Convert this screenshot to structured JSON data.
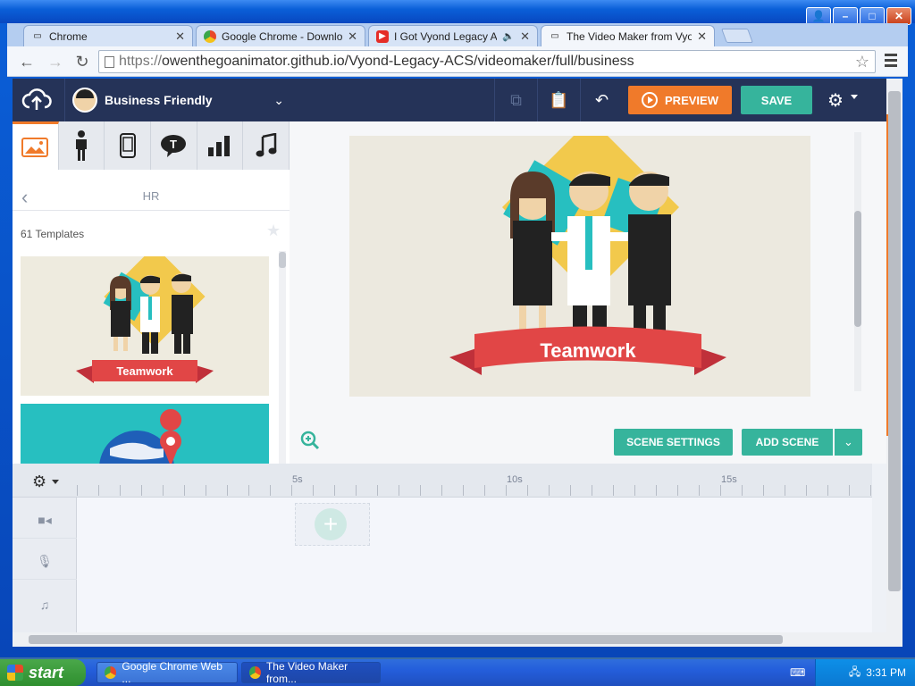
{
  "browser": {
    "tabs": [
      {
        "title": "Chrome"
      },
      {
        "title": "Google Chrome - Download t"
      },
      {
        "title": "I Got Vyond Legacy ACS"
      },
      {
        "title": "The Video Maker from Vyond"
      }
    ],
    "url_protocol": "https://",
    "url_rest": "owenthegoanimator.github.io/Vyond-Legacy-ACS/videomaker/full/business"
  },
  "app": {
    "theme_name": "Business Friendly",
    "preview_label": "PREVIEW",
    "save_label": "SAVE",
    "asset_tabs": [
      "image-icon",
      "character-icon",
      "device-icon",
      "speech-bubble-icon",
      "bar-chart-icon",
      "music-note-icon"
    ],
    "panel": {
      "title": "HR",
      "templates_count": "61 Templates",
      "thumb1_banner": "Teamwork"
    },
    "scene": {
      "banner_text": "Teamwork"
    },
    "scene_settings_label": "SCENE SETTINGS",
    "add_scene_label": "ADD SCENE",
    "timeline": {
      "marks": [
        "5s",
        "10s",
        "15s"
      ]
    },
    "colors": {
      "header": "#253358",
      "accent_orange": "#f07a2a",
      "accent_teal": "#36b49c"
    }
  },
  "taskbar": {
    "start_label": "start",
    "items": [
      "Google Chrome Web ...",
      "The Video Maker from..."
    ],
    "clock": "3:31 PM"
  }
}
